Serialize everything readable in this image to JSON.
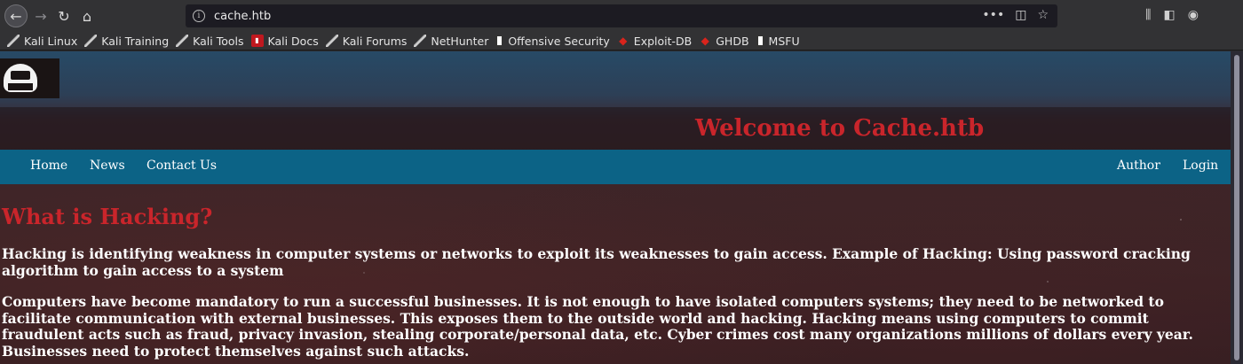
{
  "browser": {
    "url": "cache.htb",
    "icons": {
      "back": "arrow-left-icon",
      "forward": "arrow-right-icon",
      "reload": "reload-icon",
      "home": "home-icon",
      "page_actions": "ellipsis-icon",
      "pocket": "pocket-icon",
      "bookmark": "star-icon",
      "library": "library-icon",
      "sidebar": "sidebar-icon",
      "account": "account-icon"
    }
  },
  "bookmarks": [
    {
      "label": "Kali Linux",
      "icon": "kali-dragon-icon"
    },
    {
      "label": "Kali Training",
      "icon": "kali-dragon-icon"
    },
    {
      "label": "Kali Tools",
      "icon": "kali-dragon-icon"
    },
    {
      "label": "Kali Docs",
      "icon": "kali-docs-icon"
    },
    {
      "label": "Kali Forums",
      "icon": "kali-dragon-icon"
    },
    {
      "label": "NetHunter",
      "icon": "kali-dragon-icon"
    },
    {
      "label": "Offensive Security",
      "icon": "offsec-icon"
    },
    {
      "label": "Exploit-DB",
      "icon": "exploit-db-icon"
    },
    {
      "label": "GHDB",
      "icon": "exploit-db-icon"
    },
    {
      "label": "MSFU",
      "icon": "offsec-icon"
    }
  ],
  "site": {
    "title": "Welcome to Cache.htb",
    "nav_left": [
      "Home",
      "News",
      "Contact Us"
    ],
    "nav_right": [
      "Author",
      "Login"
    ],
    "heading": "What is Hacking?",
    "paragraphs": [
      "Hacking is identifying weakness in computer systems or networks to exploit its weaknesses to gain access. Example of Hacking: Using password cracking algorithm to gain access to a system",
      "Computers have become mandatory to run a successful businesses. It is not enough to have isolated computers systems; they need to be networked to facilitate communication with external businesses. This exposes them to the outside world and hacking. Hacking means using computers to commit fraudulent acts such as fraud, privacy invasion, stealing corporate/personal data, etc. Cyber crimes cost many organizations millions of dollars every year. Businesses need to protect themselves against such attacks."
    ]
  },
  "colors": {
    "title_red": "#c9252b",
    "nav_blue": "#0c6386",
    "text_white": "#ffffff"
  }
}
